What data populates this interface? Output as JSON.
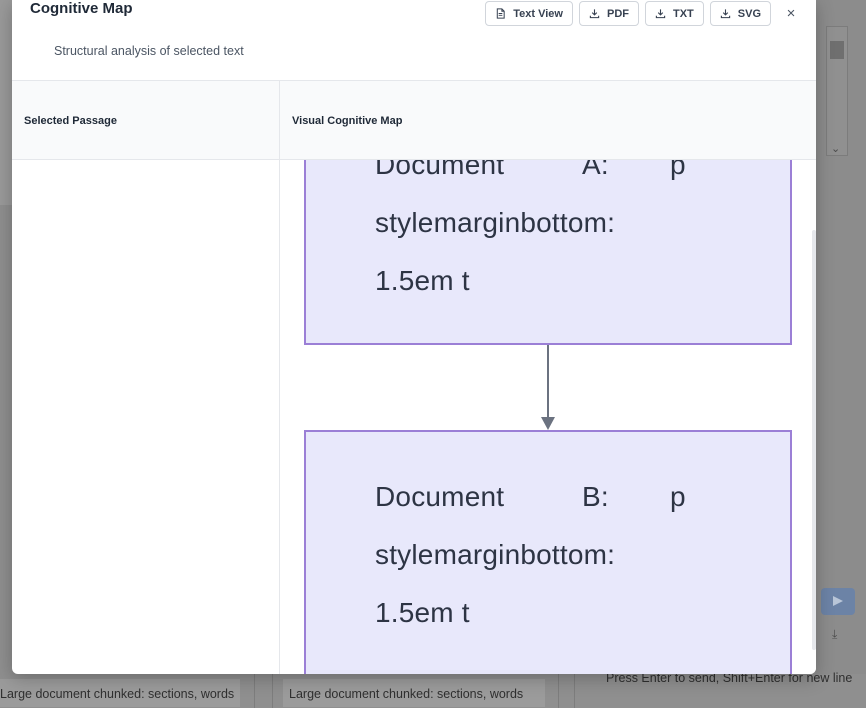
{
  "modal": {
    "title": "Cognitive Map",
    "subtitle": "Structural analysis of selected text",
    "toolbar": {
      "text_view": "Text View",
      "pdf": "PDF",
      "txt": "TXT",
      "svg": "SVG"
    },
    "close": "×"
  },
  "panels": {
    "left_header": "Selected Passage",
    "right_header": "Visual Cognitive Map"
  },
  "map": {
    "node_a": {
      "w1": "Document",
      "w2": "A:",
      "w3": "p",
      "line2": "stylemarginbottom:",
      "line3": "1.5em t"
    },
    "node_b": {
      "w1": "Document",
      "w2": "B:",
      "w3": "p",
      "line2": "stylemarginbottom:",
      "line3": "1.5em t"
    }
  },
  "background": {
    "chip_left": "Large document chunked: sections, words",
    "chip_middle": "Large document chunked: sections, words",
    "hint": "Press Enter to send, Shift+Enter for new line"
  },
  "colors": {
    "node_fill": "#e8e8fb",
    "node_border": "#9b7fd6",
    "edge": "#6b7280"
  }
}
